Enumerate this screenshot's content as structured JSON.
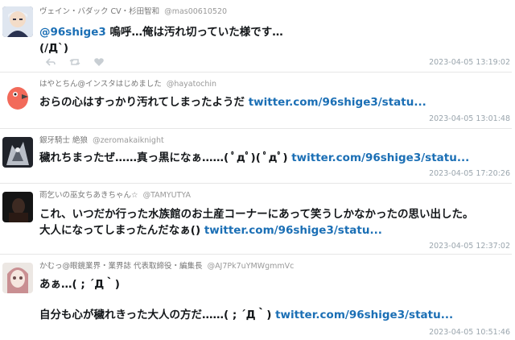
{
  "tweets": [
    {
      "name": "ヴェイン・バダック CV・杉田智和",
      "handle": "@mas00610520",
      "mention": "@96shige3",
      "text_after_mention": " 嗚呼…俺は汚れ切っていた様です…",
      "line2": "(/Д`)",
      "timestamp": "2023-04-05 13:19:02",
      "avatar": "anime-character-avatar"
    },
    {
      "name": "はやとちん@インスタはじめました",
      "handle": "@hayatochin",
      "text": "おらの心はすっかり汚れてしまったようだ ",
      "link": "twitter.com/96shige3/statu...",
      "timestamp": "2023-04-05 13:01:48",
      "avatar": "parrot-avatar"
    },
    {
      "name": "銀牙騎士 絶狼",
      "handle": "@zeromakaiknight",
      "text": "穢れちまったぜ……真っ黒になぁ……( ﾟдﾟ)( ﾟдﾟ) ",
      "link": "twitter.com/96shige3/statu...",
      "timestamp": "2023-04-05 17:20:26",
      "avatar": "armored-knight-avatar"
    },
    {
      "name": "雨乞いの巫女ちあきちゃん☆",
      "handle": "@TAMYUTYA",
      "line1": "これ、いつだか行った水族館のお土産コーナーにあって笑うしかなかったの思い出した。",
      "line2_text": "大人になってしまったんだなぁ() ",
      "link": "twitter.com/96shige3/statu...",
      "timestamp": "2023-04-05 12:37:02",
      "avatar": "dark-photo-avatar"
    },
    {
      "name": "かむっ@眼鏡業界・業界誌 代表取締役・編集長",
      "handle": "@AJ7Pk7uYMWgmmVc",
      "line1": "あぁ…( ; ´Д｀)",
      "line2_text": "自分も心が穢れきった大人の方だ……( ; ´Д｀) ",
      "link": "twitter.com/96shige3/statu...",
      "timestamp": "2023-04-05 10:51:46",
      "avatar": "doll-avatar"
    }
  ],
  "action_icons": [
    "reply-icon",
    "retweet-icon",
    "like-icon"
  ],
  "colors": {
    "link": "#1b6fb5",
    "meta": "#9aa5ad",
    "divider": "#e6e6e6"
  }
}
